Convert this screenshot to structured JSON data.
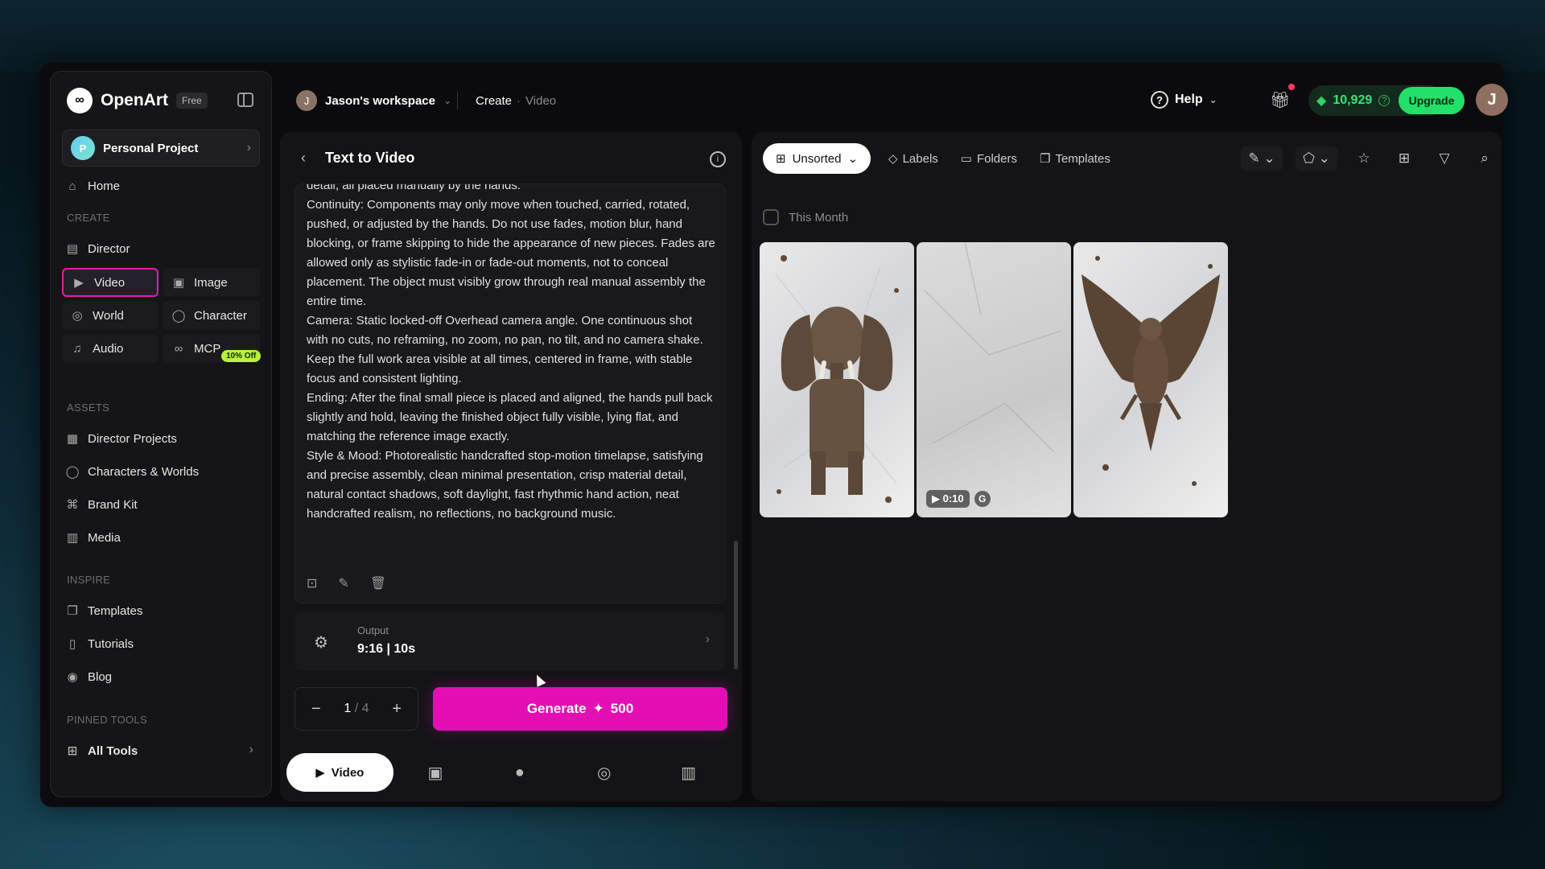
{
  "app": {
    "name": "OpenArt",
    "plan": "Free"
  },
  "project": {
    "name": "Personal Project",
    "avatar_letter": "P"
  },
  "sidebar": {
    "home": "Home",
    "create_label": "CREATE",
    "director": "Director",
    "video": "Video",
    "image": "Image",
    "world": "World",
    "character": "Character",
    "audio": "Audio",
    "mcp": "MCP",
    "mcp_badge": "10% Off",
    "assets_label": "ASSETS",
    "director_projects": "Director Projects",
    "characters_worlds": "Characters & Worlds",
    "brand_kit": "Brand Kit",
    "media": "Media",
    "inspire_label": "INSPIRE",
    "templates": "Templates",
    "tutorials": "Tutorials",
    "blog": "Blog",
    "pinned_label": "PINNED TOOLS",
    "all_tools": "All Tools"
  },
  "topbar": {
    "workspace_letter": "J",
    "workspace": "Jason's workspace",
    "crumb_1": "Create",
    "crumb_sep": "·",
    "crumb_2": "Video",
    "help": "Help",
    "credits": "10,929",
    "upgrade": "Upgrade",
    "user_letter": "J"
  },
  "panel": {
    "title": "Text to Video",
    "prompt": "detail, all placed manually by the hands.\nContinuity: Components may only move when touched, carried, rotated, pushed, or adjusted by the hands. Do not use fades, motion blur, hand blocking, or frame skipping to hide the appearance of new pieces. Fades are allowed only as stylistic fade-in or fade-out moments, not to conceal placement. The object must visibly grow through real manual assembly the entire time.\nCamera: Static locked-off Overhead camera angle. One continuous shot with no cuts, no reframing, no zoom, no pan, no tilt, and no camera shake. Keep the full work area visible at all times, centered in frame, with stable focus and consistent lighting.\nEnding: After the final small piece is placed and aligned, the hands pull back slightly and hold, leaving the finished object fully visible, lying flat, and matching the reference image exactly.\nStyle & Mood: Photorealistic handcrafted stop-motion timelapse, satisfying and precise assembly, clean minimal presentation, crisp material detail, natural contact shadows, soft daylight, fast rhythmic hand action, neat handcrafted realism, no reflections, no background music.",
    "output_label": "Output",
    "output_value": "9:16 | 10s",
    "count": "1",
    "total": "/ 4",
    "generate": "Generate",
    "generate_cost": "500"
  },
  "bottom_tabs": {
    "video": "Video"
  },
  "gallery": {
    "sort": "Unsorted",
    "labels": "Labels",
    "folders": "Folders",
    "templates": "Templates",
    "group": "This Month",
    "video_duration": "0:10",
    "video_badge": "G"
  }
}
